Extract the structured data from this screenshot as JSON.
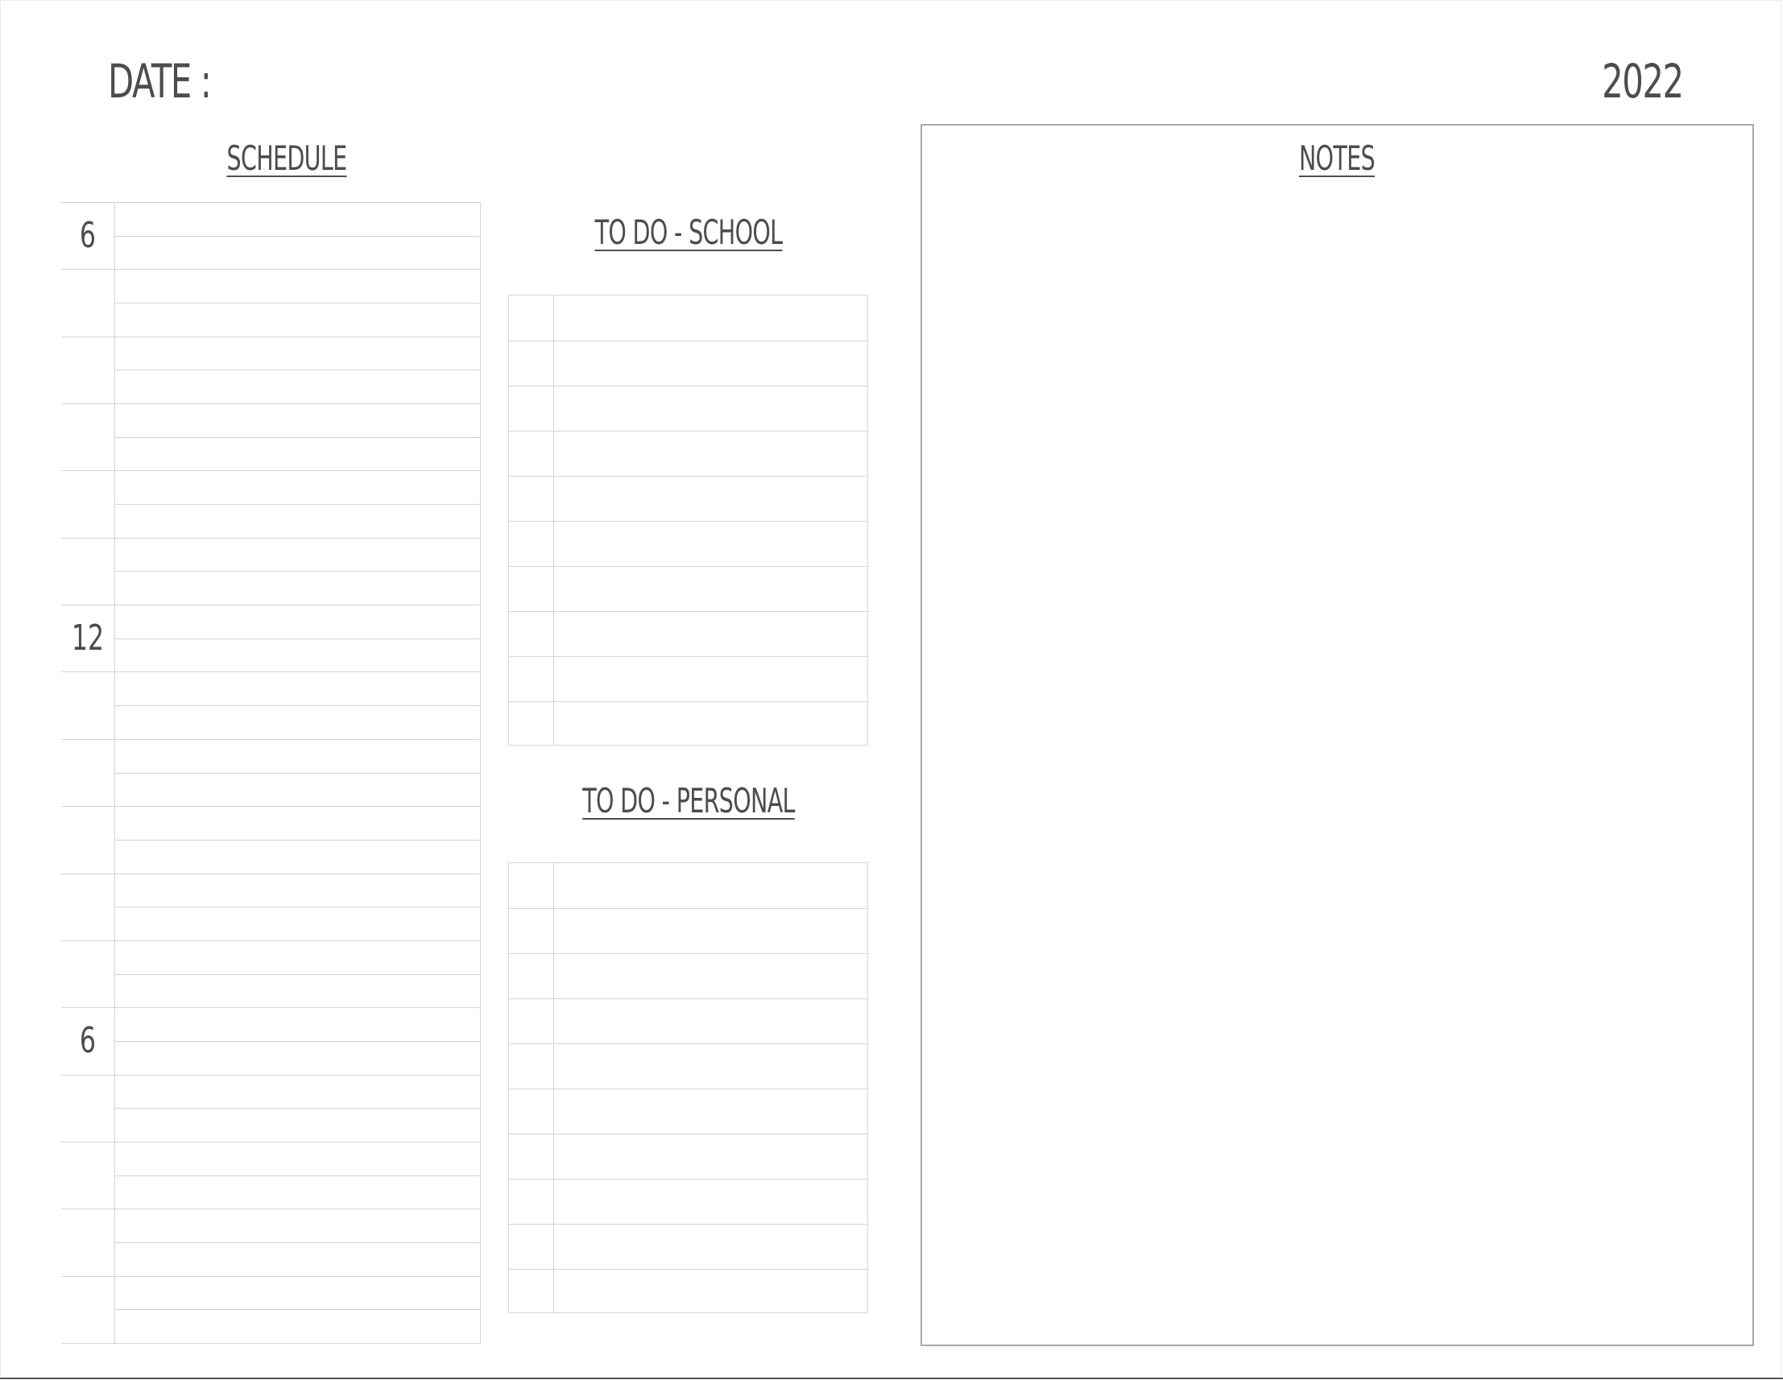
{
  "header": {
    "date_label": "DATE :",
    "year": "2022"
  },
  "schedule": {
    "title": "SCHEDULE",
    "hour_labels": [
      "6",
      "12",
      "6"
    ],
    "row_count": 34
  },
  "todo_school": {
    "title": "TO DO - SCHOOL",
    "row_count": 10
  },
  "todo_personal": {
    "title": "TO DO - PERSONAL",
    "row_count": 10
  },
  "notes": {
    "title": "NOTES"
  }
}
